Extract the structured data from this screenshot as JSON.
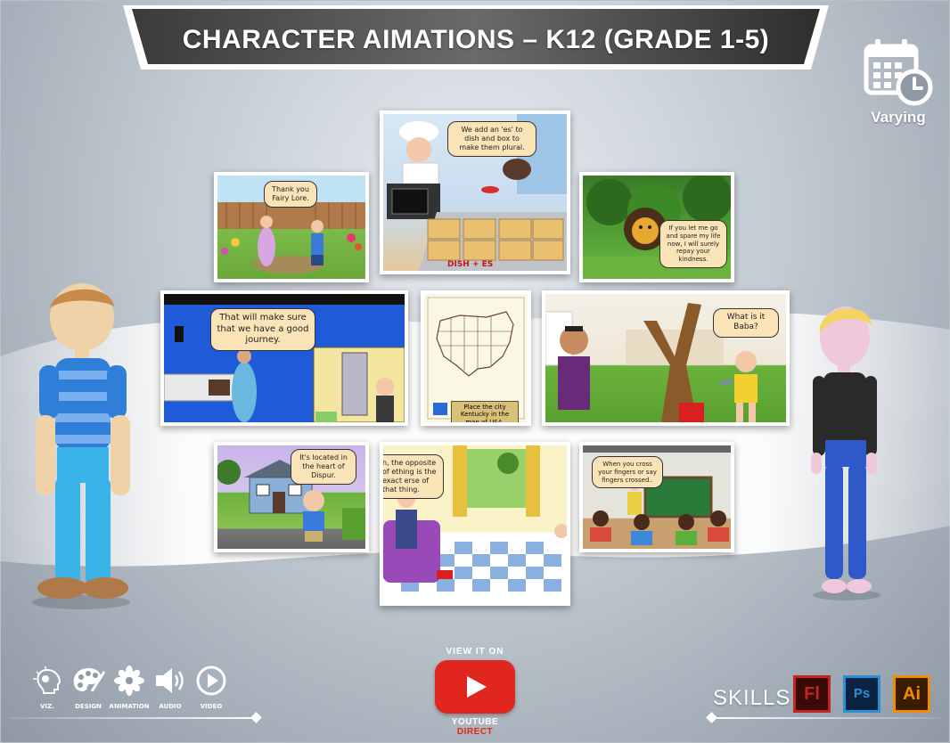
{
  "header": {
    "title": "CHARACTER AIMATIONS – K12 (GRADE 1-5)"
  },
  "schedule": {
    "icon": "calendar-clock-icon",
    "label": "Varying"
  },
  "thumbnails": [
    {
      "id": "fairy",
      "caption": "Thank you Fairy Lore."
    },
    {
      "id": "chef",
      "caption": "We add an 'es' to dish and box to make them plural.",
      "footer": "DISH + ES"
    },
    {
      "id": "lion",
      "caption": "If you let me go and spare my life now, I will surely repay your kindness."
    },
    {
      "id": "journey",
      "caption": "That will make sure that we have a good journey."
    },
    {
      "id": "map",
      "caption": "Place the city Kentucky in the map of USA."
    },
    {
      "id": "tree",
      "caption": "What is it Baba?"
    },
    {
      "id": "house",
      "caption": "It's located in the heart of Dispur."
    },
    {
      "id": "opposite",
      "caption": "n, the opposite of ething is the exact erse of that thing."
    },
    {
      "id": "classroom",
      "caption": "When you cross your fingers or say fingers crossed.."
    }
  ],
  "tools": [
    {
      "icon": "lightbulb-head-icon",
      "label": "VIZ."
    },
    {
      "icon": "palette-icon",
      "label": "DESIGN"
    },
    {
      "icon": "flower-animation-icon",
      "label": "ANIMATION"
    },
    {
      "icon": "speaker-icon",
      "label": "AUDIO"
    },
    {
      "icon": "play-circle-icon",
      "label": "VIDEO"
    }
  ],
  "youtube": {
    "top_label": "VIEW IT ON",
    "bottom_label": "YOUTUBE",
    "bottom_highlight": "DIRECT"
  },
  "skills": {
    "label": "SKILLS",
    "items": [
      {
        "icon": "flash-icon",
        "text": "Fl",
        "color": "#c0271e"
      },
      {
        "icon": "photoshop-icon",
        "text": "Ps",
        "color": "#2b8fd6"
      },
      {
        "icon": "illustrator-icon",
        "text": "Ai",
        "color": "#f28c00"
      }
    ]
  }
}
